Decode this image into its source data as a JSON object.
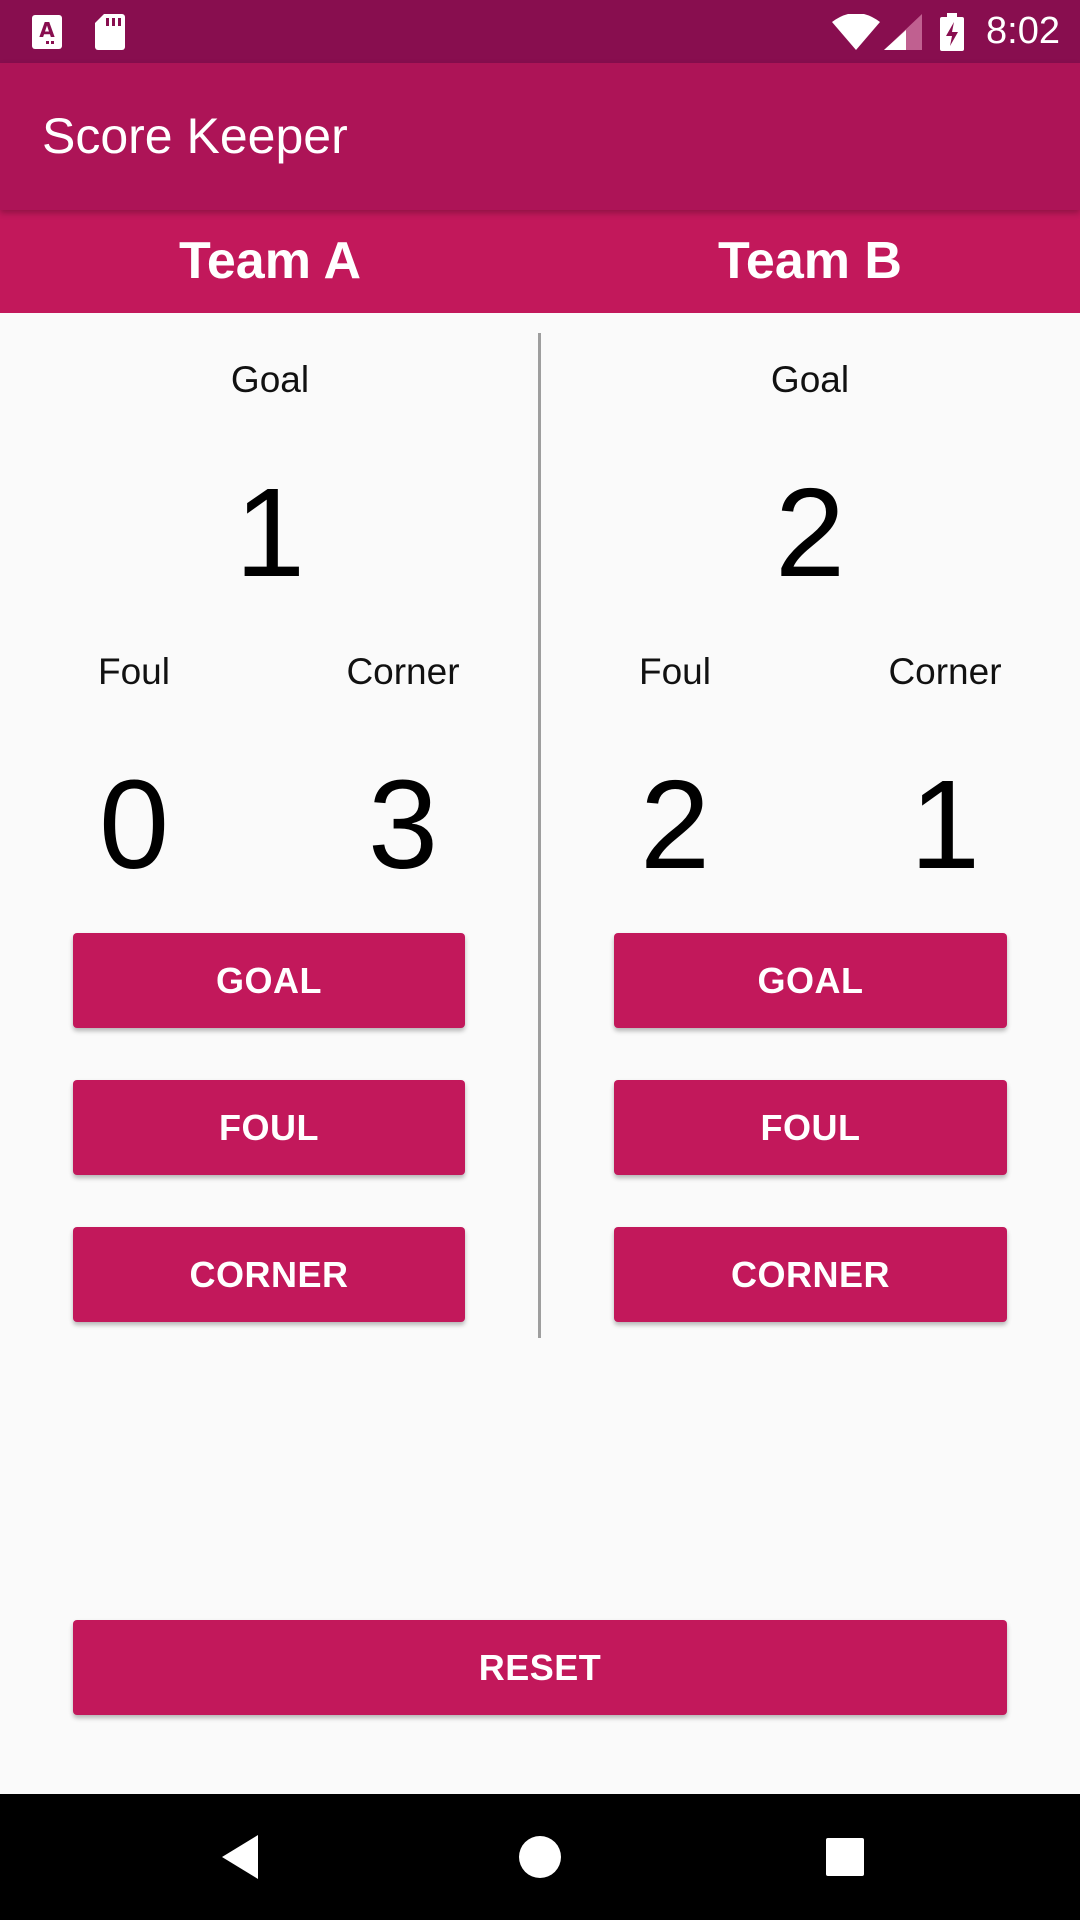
{
  "status_bar": {
    "time": "8:02",
    "icons_left": [
      "font-download-icon",
      "sd-card-icon"
    ],
    "icons_right": [
      "wifi-icon",
      "cell-signal-icon",
      "battery-charging-icon"
    ]
  },
  "app_bar": {
    "title": "Score Keeper"
  },
  "teams": [
    {
      "name": "Team A",
      "goal_label": "Goal",
      "goal_value": "1",
      "foul_label": "Foul",
      "foul_value": "0",
      "corner_label": "Corner",
      "corner_value": "3",
      "buttons": {
        "goal": "GOAL",
        "foul": "FOUL",
        "corner": "CORNER"
      }
    },
    {
      "name": "Team B",
      "goal_label": "Goal",
      "goal_value": "2",
      "foul_label": "Foul",
      "foul_value": "2",
      "corner_label": "Corner",
      "corner_value": "1",
      "buttons": {
        "goal": "GOAL",
        "foul": "FOUL",
        "corner": "CORNER"
      }
    }
  ],
  "reset_label": "RESET",
  "nav_bar": {
    "icons": [
      "back-icon",
      "home-icon",
      "recents-icon"
    ]
  },
  "colors": {
    "primary": "#AD1457",
    "primary_dark": "#880E4F",
    "accent": "#C2185B"
  }
}
